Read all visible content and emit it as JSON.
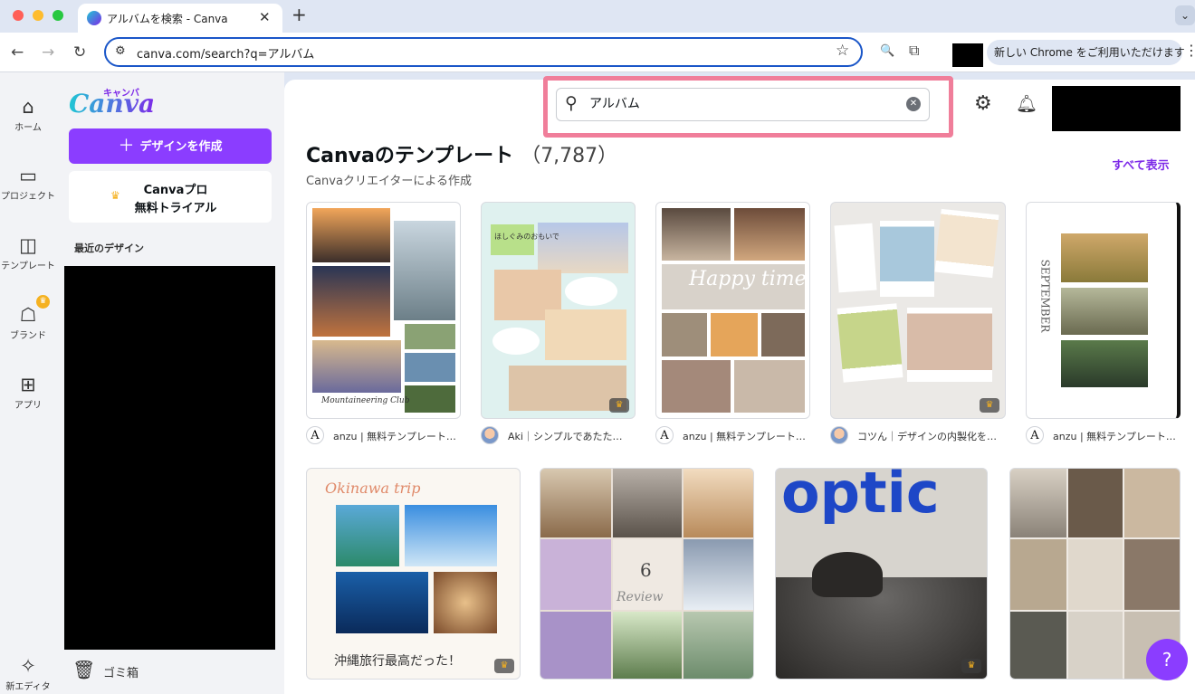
{
  "browser": {
    "tab_title": "アルバムを検索 - Canva",
    "tab_close": "✕",
    "new_tab": "+",
    "tab_menu": "⌄",
    "url": "canva.com/search?q=アルバム",
    "update_notice": "新しい Chrome をご利用いただけます",
    "kebab": "⋮",
    "traffic_colors": [
      "#ff5f57",
      "#febc2e",
      "#28c840"
    ]
  },
  "rail": {
    "items": [
      {
        "label": "ホーム",
        "icon": "⌂"
      },
      {
        "label": "プロジェクト",
        "icon": "▭"
      },
      {
        "label": "テンプレート",
        "icon": "◫"
      },
      {
        "label": "ブランド",
        "icon": "☖"
      },
      {
        "label": "アプリ",
        "icon": "⊞"
      },
      {
        "label": "新エディタ",
        "icon": "✧"
      }
    ]
  },
  "sidebar": {
    "logo_text": "Canva",
    "logo_kana": "キャンバ",
    "create_label": "デザインを作成",
    "trial_line1": "Canvaプロ",
    "trial_line2": "無料トライアル",
    "recent_label": "最近のデザイン",
    "trash_label": "ゴミ箱"
  },
  "search": {
    "value": "アルバム",
    "clear": "✕"
  },
  "main": {
    "heading": "Canvaのテンプレート",
    "count": "（7,787）",
    "subheading": "Canvaクリエイターによる作成",
    "see_all": "すべて表示"
  },
  "row1": [
    {
      "creator": "anzu | 無料テンプレート…",
      "avatar": "A",
      "pro": false,
      "caption": "Mountaineering Club"
    },
    {
      "creator": "Aki｜シンプルであたた…",
      "avatar": "",
      "pro": true,
      "caption": "ほしぐみのおもいで"
    },
    {
      "creator": "anzu | 無料テンプレート…",
      "avatar": "A",
      "pro": false,
      "caption": "Happy time"
    },
    {
      "creator": "コツん｜デザインの内製化を…",
      "avatar": "",
      "pro": true,
      "caption": ""
    },
    {
      "creator": "anzu | 無料テンプレート…",
      "avatar": "A",
      "pro": false,
      "caption": "SEPTEMBER"
    }
  ],
  "row2": [
    {
      "title": "Okinawa trip",
      "footer": "沖縄旅行最高だった！",
      "pro": true
    },
    {
      "title": "6",
      "footer": "Review",
      "pro": false
    },
    {
      "title": "optic",
      "footer": "",
      "pro": true
    },
    {
      "title": "",
      "footer": "",
      "pro": false
    }
  ],
  "crown_glyph": "♛",
  "help_label": "?",
  "colors": {
    "accent": "#8b3dff",
    "highlight": "#f07e9a",
    "brand_gradient_start": "#1fc7d4",
    "optic_blue": "#1e47c7"
  }
}
